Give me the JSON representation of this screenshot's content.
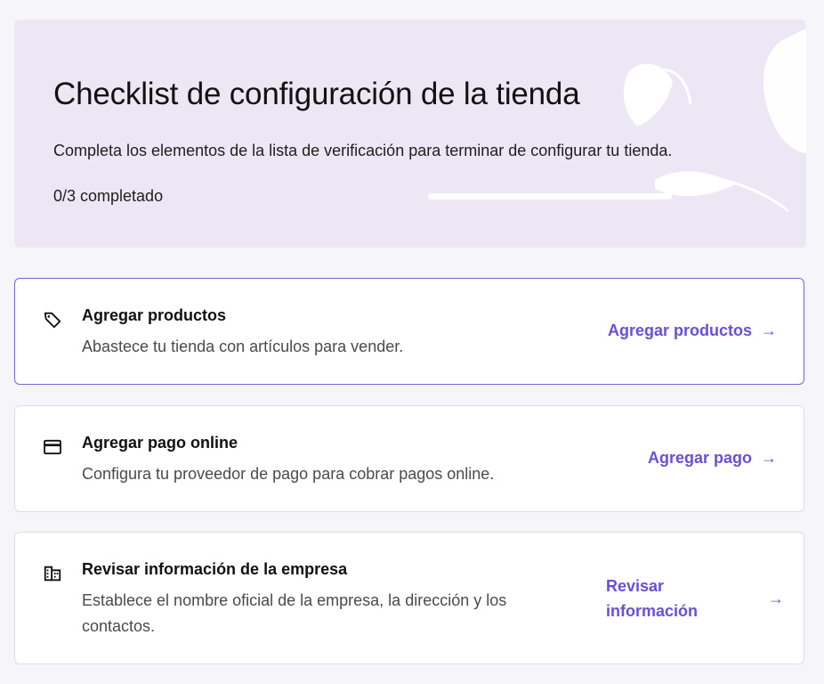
{
  "header": {
    "title": "Checklist de configuración de la tienda",
    "subtitle": "Completa los elementos de la lista de verificación para terminar de configurar tu tienda.",
    "progress_text": "0/3 completado",
    "progress_fraction": 0
  },
  "tasks": [
    {
      "icon": "tag-icon",
      "title": "Agregar productos",
      "description": "Abastece tu tienda con artículos para vender.",
      "action": "Agregar productos"
    },
    {
      "icon": "credit-card-icon",
      "title": "Agregar pago online",
      "description": "Configura tu proveedor de pago para cobrar pagos online.",
      "action": "Agregar pago"
    },
    {
      "icon": "building-icon",
      "title": "Revisar información de la empresa",
      "description": "Establece el nombre oficial de la empresa, la dirección y los contactos.",
      "action": "Revisar información"
    }
  ],
  "colors": {
    "accent": "#6a4fd6",
    "hero_background": "#ede6f4",
    "page_background": "#f6f6fa"
  }
}
